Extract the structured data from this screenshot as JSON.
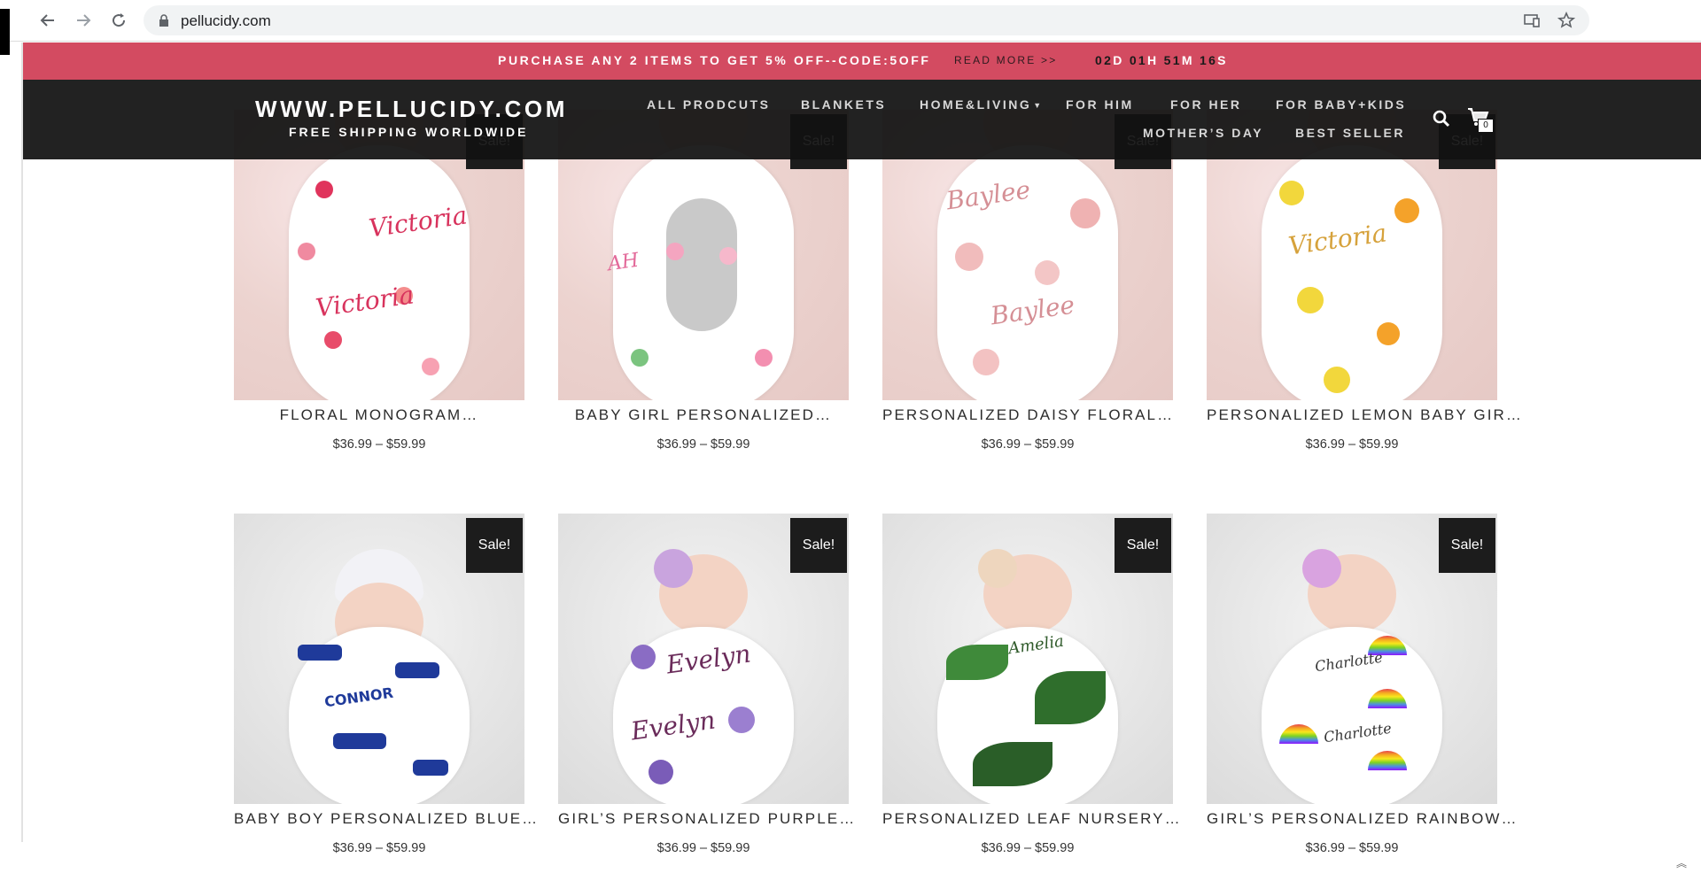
{
  "browser": {
    "url": "pellucidy.com"
  },
  "promo": {
    "text": "PURCHASE ANY 2 ITEMS TO GET 5% OFF--CODE:5OFF",
    "read_more": "READ MORE >>",
    "countdown": {
      "d": "02",
      "d_unit": "D",
      "h": "01",
      "h_unit": "H",
      "m": "51",
      "m_unit": "M",
      "s": "16",
      "s_unit": "S"
    }
  },
  "header": {
    "brand_title": "WWW.PELLUCIDY.COM",
    "brand_subtitle": "FREE SHIPPING WORLDWIDE",
    "cart_count": "0",
    "menu": [
      {
        "label": "ALL PRODCUTS"
      },
      {
        "label": "BLANKETS"
      },
      {
        "label": "HOME&LIVING"
      },
      {
        "label": "FOR HIM"
      },
      {
        "label": "FOR HER"
      },
      {
        "label": "FOR BABY+KIDS"
      },
      {
        "label": "MOTHER’S DAY"
      },
      {
        "label": "BEST SELLER"
      }
    ]
  },
  "products": [
    {
      "title": "FLORAL MONOGRAM…",
      "price": "$36.99 – $59.99",
      "badge": "Sale!",
      "swaddle_text": "Victoria",
      "name_color": "#d8335d"
    },
    {
      "title": "BABY GIRL PERSONALIZED…",
      "price": "$36.99 – $59.99",
      "badge": "Sale!",
      "swaddle_text": "AH",
      "name_color": "#e36a9a"
    },
    {
      "title": "PERSONALIZED DAISY FLORAL…",
      "price": "$36.99 – $59.99",
      "badge": "Sale!",
      "swaddle_text": "Baylee",
      "name_color": "#d58f95"
    },
    {
      "title": "PERSONALIZED LEMON BABY GIR…",
      "price": "$36.99 – $59.99",
      "badge": "Sale!",
      "swaddle_text": "Victoria",
      "name_color": "#d6a23c"
    },
    {
      "title": "BABY BOY PERSONALIZED BLUE…",
      "price": "$36.99 – $59.99",
      "badge": "Sale!",
      "swaddle_text": "CONNOR",
      "name_color": "#1f3a9a"
    },
    {
      "title": "GIRL’S PERSONALIZED PURPLE…",
      "price": "$36.99 – $59.99",
      "badge": "Sale!",
      "swaddle_text": "Evelyn",
      "name_color": "#6a2b5a"
    },
    {
      "title": "PERSONALIZED LEAF NURSERY…",
      "price": "$36.99 – $59.99",
      "badge": "Sale!",
      "swaddle_text": "Amelia",
      "name_color": "#2f5a2a"
    },
    {
      "title": "GIRL’S PERSONALIZED RAINBOW…",
      "price": "$36.99 – $59.99",
      "badge": "Sale!",
      "swaddle_text": "Charlotte",
      "name_color": "#333333"
    }
  ],
  "colors": {
    "promo_bg": "#d34b61",
    "header_bg": "#111111",
    "badge_bg": "#1c1c1c"
  },
  "icons": [
    "back-arrow-icon",
    "forward-arrow-icon",
    "reload-icon",
    "lock-icon",
    "cast-icon",
    "star-icon",
    "search-icon",
    "cart-icon",
    "scroll-up-icon"
  ]
}
